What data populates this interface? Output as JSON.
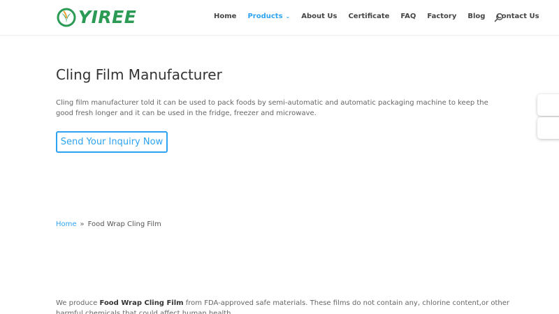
{
  "brand": {
    "name": "YIREE",
    "green": "#2a9a55",
    "accent": "#2ea3f2"
  },
  "nav": {
    "items": [
      {
        "label": "Home"
      },
      {
        "label": "Products"
      },
      {
        "label": "About Us"
      },
      {
        "label": "Certificate"
      },
      {
        "label": "FAQ"
      },
      {
        "label": "Factory"
      },
      {
        "label": "Blog"
      },
      {
        "label": "Contact Us"
      }
    ],
    "active": "Products",
    "search_icon": "search-icon"
  },
  "hero": {
    "title": "Cling Film Manufacturer",
    "intro": "Cling film manufacturer told it can be used to pack foods by semi-automatic and automatic packaging machine to keep the good fresh longer and it can be used in the fridge, freezer and microwave.",
    "button_label": "Send Your Inquiry Now"
  },
  "breadcrumb": {
    "home": "Home",
    "separator": "»",
    "current": "Food Wrap Cling Film"
  },
  "content": {
    "lead": "We produce ",
    "bold": "Food Wrap Cling Film",
    "rest": " from FDA-approved safe materials. These films do not contain any, chlorine content,or other harmful chemicals that could affect human health."
  }
}
